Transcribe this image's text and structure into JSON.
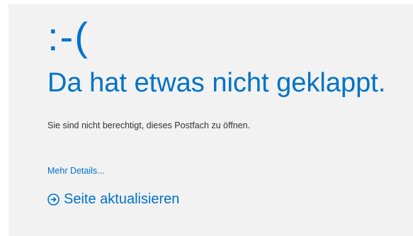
{
  "error": {
    "emoticon": ":-(",
    "title": "Da hat etwas nicht geklappt.",
    "message": "Sie sind nicht berechtigt, dieses Postfach zu öffnen.",
    "details_link": "Mehr Details...",
    "refresh_label": "Seite aktualisieren",
    "refresh_icon": "circle-arrow-right-icon"
  },
  "colors": {
    "accent": "#0072c6",
    "background": "#f2f2f2",
    "text": "#333333"
  }
}
